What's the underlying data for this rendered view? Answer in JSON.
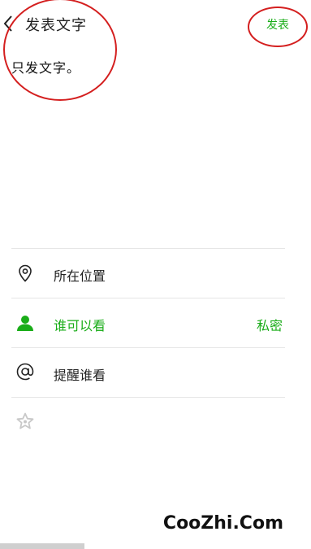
{
  "header": {
    "back_icon": "chevron-left-icon",
    "title": "发表文字",
    "publish_label": "发表"
  },
  "post": {
    "text": "只发文字。"
  },
  "options": [
    {
      "icon": "location-pin-icon",
      "label": "所在位置",
      "value": ""
    },
    {
      "icon": "person-icon",
      "label": "谁可以看",
      "value": "私密"
    },
    {
      "icon": "at-icon",
      "label": "提醒谁看",
      "value": ""
    },
    {
      "icon": "star-icon",
      "label": "",
      "value": ""
    }
  ],
  "colors": {
    "accent": "#1aad19",
    "annotation": "#d41f1f",
    "muted_icon": "#c8c8c8"
  },
  "watermark": "CooZhi.Com"
}
